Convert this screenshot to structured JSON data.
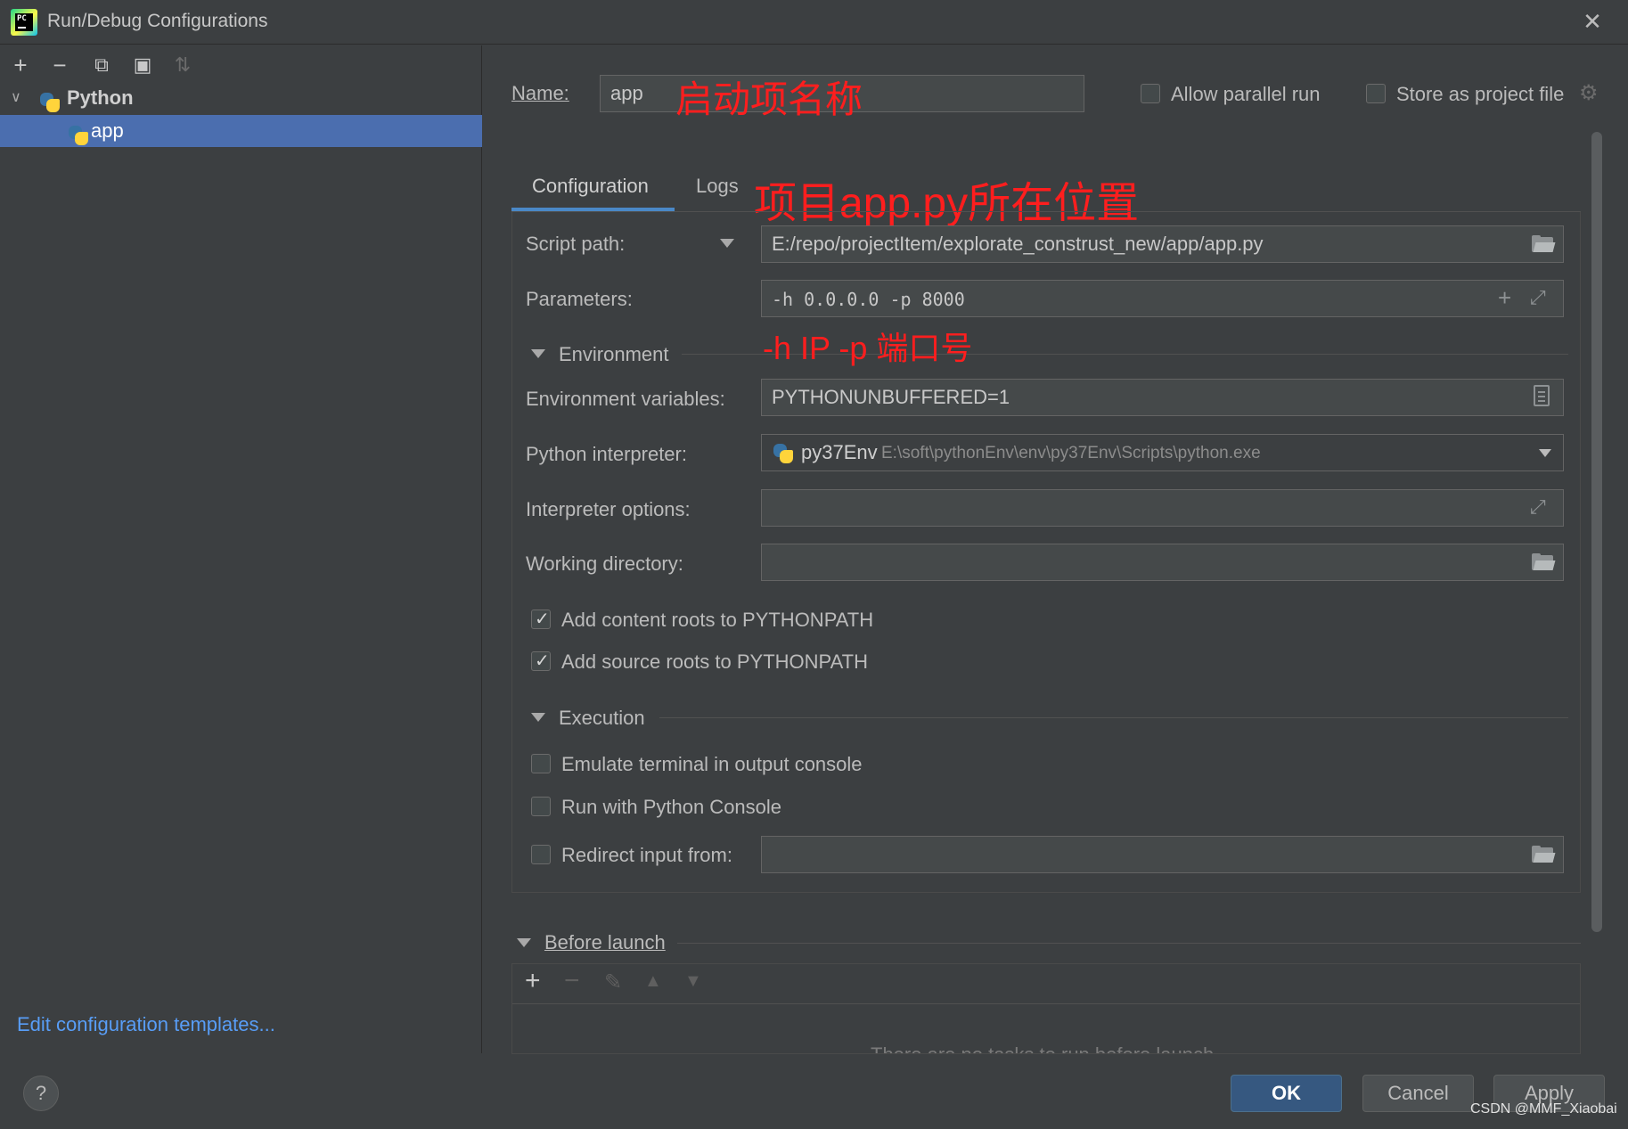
{
  "window": {
    "title": "Run/Debug Configurations",
    "close_glyph": "✕"
  },
  "left_panel": {
    "toolbar": {
      "add": "+",
      "remove": "−",
      "copy": "⧉",
      "new_folder": "▣",
      "sort": "⇅"
    },
    "tree": {
      "group_label": "Python",
      "item_label": "app"
    },
    "edit_templates": "Edit configuration templates..."
  },
  "header": {
    "name_label": "Name:",
    "name_value": "app",
    "name_note": "启动项名称",
    "allow_parallel_label": "Allow parallel run",
    "store_project_label": "Store as project file"
  },
  "tabs": {
    "configuration": "Configuration",
    "logs": "Logs",
    "tabs_note": "项目app.py所在位置"
  },
  "form": {
    "script_path_label": "Script path:",
    "script_path_value": "E:/repo/projectItem/explorate_construst_new/app/app.py",
    "parameters_label": "Parameters:",
    "parameters_value": "-h 0.0.0.0 -p 8000",
    "parameters_note": "-h IP -p 端口号",
    "environment_section": "Environment",
    "env_vars_label": "Environment variables:",
    "env_vars_value": "PYTHONUNBUFFERED=1",
    "interpreter_label": "Python interpreter:",
    "interpreter_name": "py37Env",
    "interpreter_path": "E:\\soft\\pythonEnv\\env\\py37Env\\Scripts\\python.exe",
    "interpreter_options_label": "Interpreter options:",
    "working_dir_label": "Working directory:",
    "add_content_roots_label": "Add content roots to PYTHONPATH",
    "add_source_roots_label": "Add source roots to PYTHONPATH",
    "execution_section": "Execution",
    "emulate_terminal_label": "Emulate terminal in output console",
    "run_console_label": "Run with Python Console",
    "redirect_input_label": "Redirect input from:"
  },
  "before_launch": {
    "section": "Before launch",
    "empty_text": "There are no tasks to run before launch"
  },
  "buttons": {
    "help": "?",
    "ok": "OK",
    "cancel": "Cancel",
    "apply": "Apply"
  },
  "watermark": "CSDN @MMF_Xiaobai",
  "colors": {
    "background": "#3c3f41",
    "selection": "#4b6eaf",
    "accent_tab": "#4a88c7",
    "link": "#589df6",
    "annotation_red": "#ff1e1e",
    "ok_button": "#365880"
  }
}
